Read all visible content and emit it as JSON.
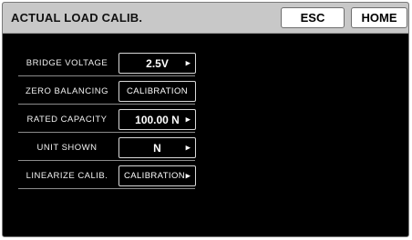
{
  "header": {
    "title": "ACTUAL LOAD CALIB.",
    "esc_label": "ESC",
    "home_label": "HOME"
  },
  "settings": [
    {
      "label": "BRIDGE VOLTAGE",
      "value": "2.5V",
      "has_arrow": true
    },
    {
      "label": "ZERO BALANCING",
      "value": "CALIBRATION",
      "has_arrow": false
    },
    {
      "label": "RATED CAPACITY",
      "value": "100.00 N",
      "has_arrow": true
    },
    {
      "label": "UNIT SHOWN",
      "value": "N",
      "has_arrow": true
    },
    {
      "label": "LINEARIZE CALIB.",
      "value": "CALIBRATION",
      "has_arrow": true
    }
  ],
  "icons": {
    "arrow": "right-triangle-icon"
  },
  "colors": {
    "background": "#000000",
    "titlebar": "#c8c8c8",
    "text": "#ffffff"
  }
}
